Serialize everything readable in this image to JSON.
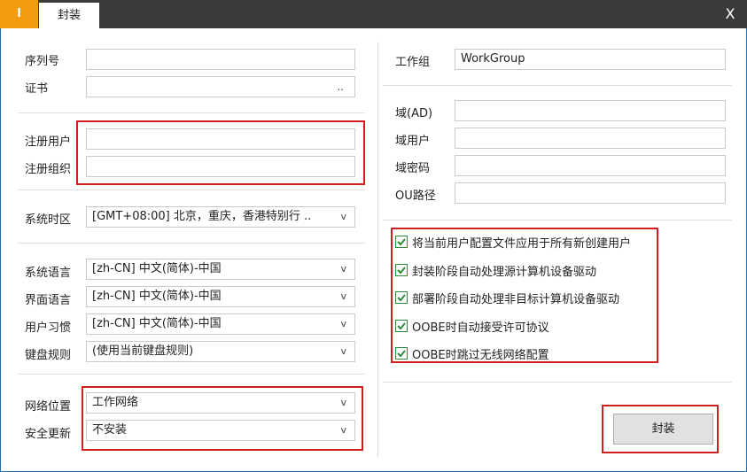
{
  "titlebar": {
    "app_tab": "I",
    "doc_tab": "封装",
    "close": "X"
  },
  "left": {
    "serial": {
      "label": "序列号",
      "value": ""
    },
    "cert": {
      "label": "证书",
      "value": "",
      "browse": ".."
    },
    "reg_user": {
      "label": "注册用户",
      "value": ""
    },
    "reg_org": {
      "label": "注册组织",
      "value": ""
    },
    "timezone": {
      "label": "系统时区",
      "value": "[GMT+08:00] 北京，重庆，香港特别行 .."
    },
    "sys_lang": {
      "label": "系统语言",
      "value": "[zh-CN] 中文(简体)-中国"
    },
    "ui_lang": {
      "label": "界面语言",
      "value": "[zh-CN] 中文(简体)-中国"
    },
    "user_locale": {
      "label": "用户习惯",
      "value": "[zh-CN] 中文(简体)-中国"
    },
    "keyboard": {
      "label": "键盘规则",
      "value": "(使用当前键盘规则)"
    },
    "net_location": {
      "label": "网络位置",
      "value": "工作网络"
    },
    "updates": {
      "label": "安全更新",
      "value": "不安装"
    }
  },
  "right": {
    "workgroup": {
      "label": "工作组",
      "value": "WorkGroup"
    },
    "domain": {
      "label": "域(AD)",
      "value": ""
    },
    "domain_user": {
      "label": "域用户",
      "value": ""
    },
    "domain_pwd": {
      "label": "域密码",
      "value": ""
    },
    "ou_path": {
      "label": "OU路径",
      "value": ""
    },
    "options": [
      "将当前用户配置文件应用于所有新创建用户",
      "封装阶段自动处理源计算机设备驱动",
      "部署阶段自动处理非目标计算机设备驱动",
      "OOBE时自动接受许可协议",
      "OOBE时跳过无线网络配置"
    ],
    "seal_button": "封装"
  },
  "icons": {
    "dropdown": "chevron-down-icon",
    "check": "check-icon",
    "close": "close-icon"
  },
  "colors": {
    "accent": "#f39c12",
    "titlebar": "#3a3a3a",
    "highlight": "#d11f1f",
    "check": "#2a8a3a"
  }
}
